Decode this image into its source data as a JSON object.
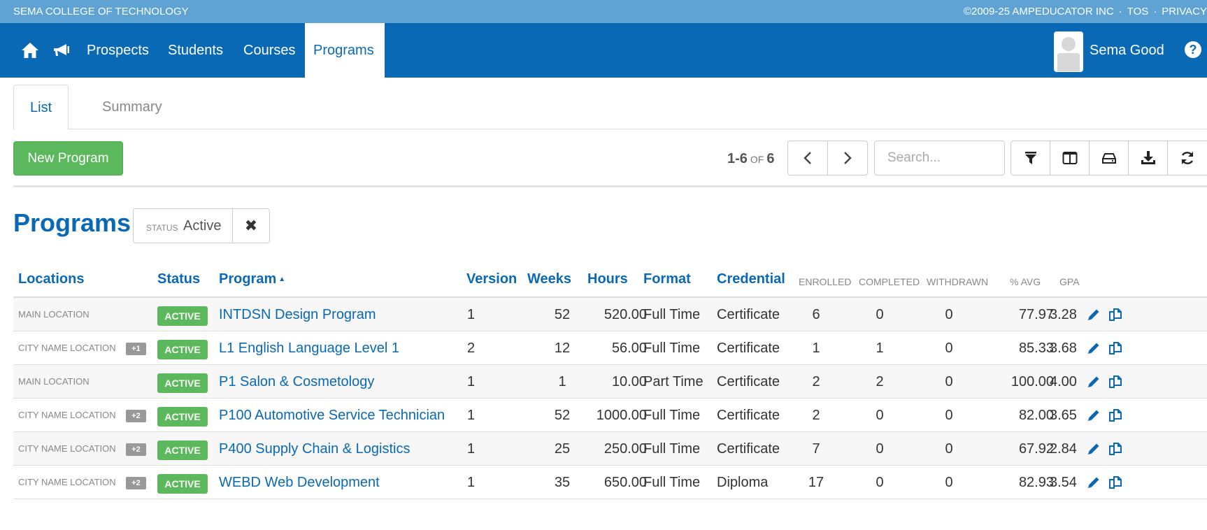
{
  "topbar": {
    "school_name": "SEMA COLLEGE OF TECHNOLOGY",
    "copyright": "©2009-25 AMPEDUCATOR INC",
    "sep": "·",
    "tos": "TOS",
    "privacy": "PRIVACY"
  },
  "nav": {
    "items": [
      {
        "label": "Prospects"
      },
      {
        "label": "Students"
      },
      {
        "label": "Courses"
      },
      {
        "label": "Programs"
      }
    ],
    "active": "Programs",
    "user_name": "Sema Good",
    "help_glyph": "?"
  },
  "tabs": [
    {
      "label": "List",
      "active": true
    },
    {
      "label": "Summary",
      "active": false
    }
  ],
  "toolbar": {
    "new_button": "New Program",
    "range": "1-6",
    "of": "OF",
    "total": "6",
    "search_placeholder": "Search..."
  },
  "page": {
    "title": "Programs",
    "filter_key": "STATUS",
    "filter_value": "Active",
    "clear_glyph": "✖"
  },
  "table": {
    "headers": {
      "locations": "Locations",
      "status": "Status",
      "program": "Program",
      "sort_indicator": "▲",
      "version": "Version",
      "weeks": "Weeks",
      "hours": "Hours",
      "format": "Format",
      "credential": "Credential",
      "enrolled": "ENROLLED",
      "completed": "COMPLETED",
      "withdrawn": "WITHDRAWN",
      "pct_avg": "% AVG",
      "gpa": "GPA"
    },
    "rows": [
      {
        "location": "MAIN LOCATION",
        "extra": "",
        "status": "ACTIVE",
        "program": "INTDSN Design Program",
        "version": "1",
        "weeks": "52",
        "hours": "520.00",
        "format": "Full Time",
        "credential": "Certificate",
        "enrolled": "6",
        "completed": "0",
        "withdrawn": "0",
        "pct_avg": "77.97",
        "gpa": "3.28"
      },
      {
        "location": "CITY NAME LOCATION",
        "extra": "+1",
        "status": "ACTIVE",
        "program": "L1 English Language Level 1",
        "version": "2",
        "weeks": "12",
        "hours": "56.00",
        "format": "Full Time",
        "credential": "Certificate",
        "enrolled": "1",
        "completed": "1",
        "withdrawn": "0",
        "pct_avg": "85.33",
        "gpa": "3.68"
      },
      {
        "location": "MAIN LOCATION",
        "extra": "",
        "status": "ACTIVE",
        "program": "P1 Salon & Cosmetology",
        "version": "1",
        "weeks": "1",
        "hours": "10.00",
        "format": "Part Time",
        "credential": "Certificate",
        "enrolled": "2",
        "completed": "2",
        "withdrawn": "0",
        "pct_avg": "100.00",
        "gpa": "4.00"
      },
      {
        "location": "CITY NAME LOCATION",
        "extra": "+2",
        "status": "ACTIVE",
        "program": "P100 Automotive Service Technician",
        "version": "1",
        "weeks": "52",
        "hours": "1000.00",
        "format": "Full Time",
        "credential": "Certificate",
        "enrolled": "2",
        "completed": "0",
        "withdrawn": "0",
        "pct_avg": "82.00",
        "gpa": "3.65"
      },
      {
        "location": "CITY NAME LOCATION",
        "extra": "+2",
        "status": "ACTIVE",
        "program": "P400 Supply Chain & Logistics",
        "version": "1",
        "weeks": "25",
        "hours": "250.00",
        "format": "Full Time",
        "credential": "Certificate",
        "enrolled": "7",
        "completed": "0",
        "withdrawn": "0",
        "pct_avg": "67.92",
        "gpa": "2.84"
      },
      {
        "location": "CITY NAME LOCATION",
        "extra": "+2",
        "status": "ACTIVE",
        "program": "WEBD Web Development",
        "version": "1",
        "weeks": "35",
        "hours": "650.00",
        "format": "Full Time",
        "credential": "Diploma",
        "enrolled": "17",
        "completed": "0",
        "withdrawn": "0",
        "pct_avg": "82.93",
        "gpa": "3.54"
      }
    ]
  },
  "colors": {
    "topstrip": "#5ea3d4",
    "navbar": "#0a69b4",
    "primary_text": "#0a69b4",
    "success": "#5cb85c"
  }
}
